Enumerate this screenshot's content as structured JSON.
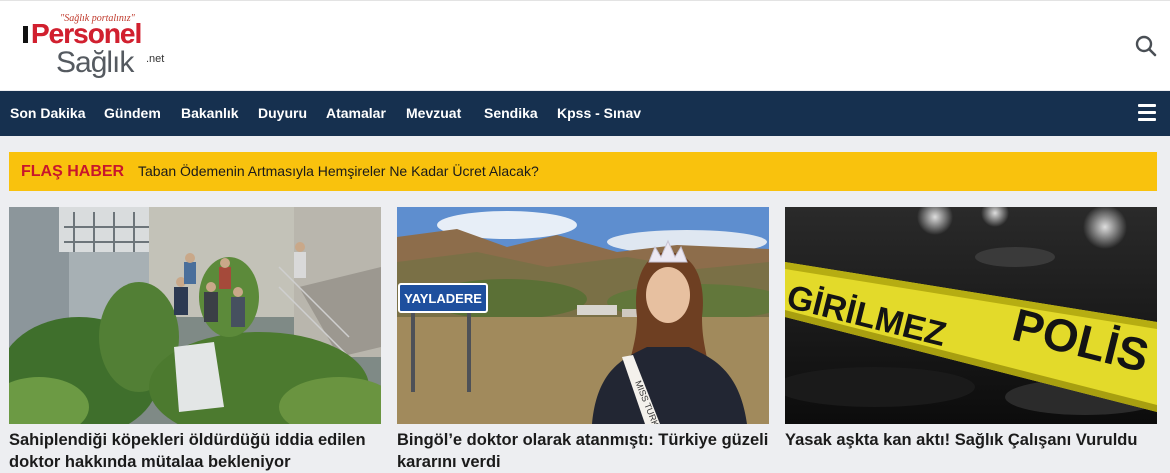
{
  "logo": {
    "tagline": "\"Sağlık portalınız\"",
    "word1": "Personel",
    "word2": "Sağlık",
    "tld": ".net"
  },
  "header": {
    "search_icon": "search-icon"
  },
  "nav": {
    "items": [
      "Son Dakika",
      "Gündem",
      "Bakanlık",
      "Duyuru",
      "Atamalar",
      "Mevzuat",
      "Sendika",
      "Kpss - Sınav"
    ],
    "menu_icon": "hamburger-icon"
  },
  "flash": {
    "label": "FLAŞ HABER",
    "text": "Taban Ödemenin Artmasıyla Hemşireler Ne Kadar Ücret Alacak?"
  },
  "news": [
    {
      "title": "Sahiplendiği köpekleri öldürdüğü iddia edilen doktor hakkında mütalaa bekleniyor"
    },
    {
      "title": "Bingöl’e doktor olarak atanmıştı: Türkiye güzeli kararını verdi",
      "sign_text": "YAYLADERE",
      "sash_text": "MISS TURKEY"
    },
    {
      "title": "Yasak aşkta kan aktı! Sağlık Çalışanı Vuruldu",
      "tape_text_1": "GİRİLMEZ",
      "tape_text_2": "POLİS"
    }
  ],
  "colors": {
    "nav_bg": "#16304f",
    "flash_bg": "#f9c20d",
    "flash_label": "#c8162c",
    "brand_red": "#d1202f"
  }
}
